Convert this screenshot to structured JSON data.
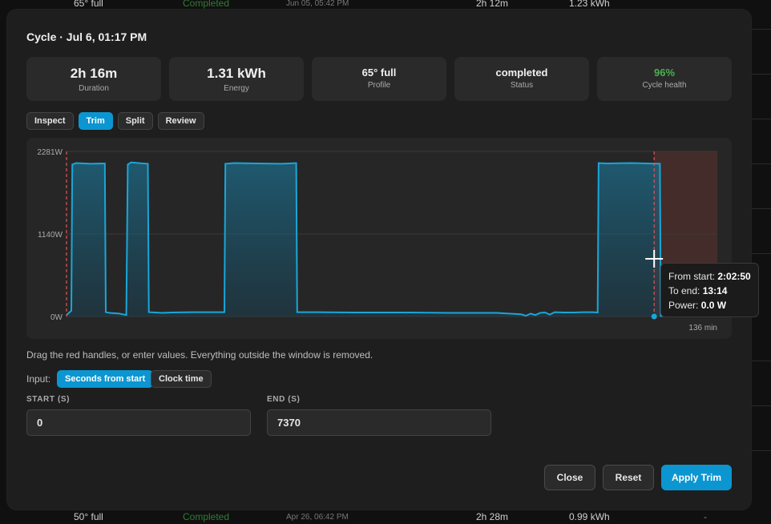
{
  "background_rows": [
    {
      "profile": "65° full ",
      "status": "Completed",
      "date": "Jun 05, 05:42 PM",
      "duration": "2h 12m",
      "energy": "1.23 kWh",
      "dash": ""
    },
    {
      "profile": "50° full",
      "status": "Completed",
      "date": "Apr 26, 06:42 PM",
      "duration": "2h 28m",
      "energy": "0.99 kWh",
      "dash": "-"
    }
  ],
  "modal": {
    "title": "Cycle · Jul 6, 01:17 PM",
    "stats": [
      {
        "value": "2h 16m",
        "label": "Duration"
      },
      {
        "value": "1.31 kWh",
        "label": "Energy"
      },
      {
        "value": "65° full",
        "label": "Profile"
      },
      {
        "value": "completed",
        "label": "Status"
      },
      {
        "value": "96%",
        "label": "Cycle health",
        "color": "#4caf50"
      }
    ],
    "tabs": [
      "Inspect",
      "Trim",
      "Split",
      "Review"
    ],
    "active_tab": "Trim",
    "hint": "Drag the red handles, or enter values. Everything outside the window is removed.",
    "input_label": "Input:",
    "input_modes": [
      "Seconds from start",
      "Clock time"
    ],
    "active_mode": "Seconds from start",
    "start_label": "START (S)",
    "start_value": "0",
    "end_label": "END (S)",
    "end_value": "7370",
    "buttons": {
      "close": "Close",
      "reset": "Reset",
      "apply": "Apply Trim"
    }
  },
  "tooltip": {
    "from_start_label": "From start:",
    "from_start_value": "2:02:50",
    "to_end_label": "To end:",
    "to_end_value": "13:14",
    "power_label": "Power:",
    "power_value": "0.0 W"
  },
  "chart_data": {
    "type": "area",
    "y_tick_labels": [
      "2281W",
      "1140W",
      "0W"
    ],
    "x_end_label": "136 min",
    "ylim": [
      0,
      2281
    ],
    "xlim_min": [
      0,
      136
    ],
    "grid": true,
    "trim_start_min": 0,
    "trim_end_min": 122.8,
    "series": [
      {
        "x_min": [
          0,
          1,
          1.2,
          2,
          5,
          8,
          8.2,
          9,
          11,
          12.5,
          12.8,
          13.5,
          15,
          17,
          17.2,
          20,
          22,
          26,
          30,
          33,
          33.2,
          35,
          40,
          45,
          48,
          48.2,
          52,
          60,
          70,
          80,
          90,
          95,
          96,
          97,
          98,
          99,
          100,
          101,
          102,
          104,
          106,
          108,
          110,
          111,
          111.2,
          113,
          118,
          124,
          124.2,
          126,
          130,
          136
        ],
        "y_w": [
          20,
          80,
          2100,
          2120,
          2110,
          2115,
          60,
          50,
          40,
          20,
          2100,
          2130,
          2120,
          2110,
          60,
          50,
          55,
          60,
          60,
          60,
          2110,
          2120,
          2115,
          2110,
          2120,
          60,
          60,
          55,
          55,
          50,
          50,
          30,
          10,
          40,
          20,
          50,
          55,
          25,
          60,
          55,
          55,
          60,
          60,
          55,
          2120,
          2115,
          2120,
          2110,
          5,
          10,
          0,
          0
        ]
      }
    ]
  },
  "colors": {
    "accent": "#0b96d1",
    "line": "#1aa6d8",
    "trim_handle": "#e05555",
    "trim_region": "#4a2e2c",
    "health_green": "#4caf50"
  }
}
